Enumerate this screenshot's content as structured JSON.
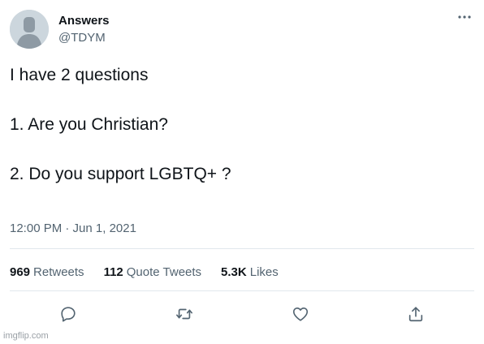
{
  "author": {
    "display_name": "Answers",
    "handle": "@TDYM"
  },
  "tweet": {
    "lines": [
      "I have 2 questions",
      "1. Are you Christian?",
      "2. Do you support LGBTQ+ ?"
    ],
    "timestamp": "12:00 PM · Jun 1, 2021"
  },
  "stats": [
    {
      "count": "969",
      "label": "Retweets"
    },
    {
      "count": "112",
      "label": "Quote Tweets"
    },
    {
      "count": "5.3K",
      "label": "Likes"
    }
  ],
  "actions": {
    "reply_icon": "reply-icon",
    "retweet_icon": "retweet-icon",
    "like_icon": "heart-icon",
    "share_icon": "share-icon"
  },
  "watermark": "imgflip.com",
  "colors": {
    "text": "#0f1419",
    "secondary": "#536471",
    "divider": "#e1e8ed",
    "avatar_bg": "#ccd6dd",
    "avatar_fg": "#9aa6b0"
  }
}
